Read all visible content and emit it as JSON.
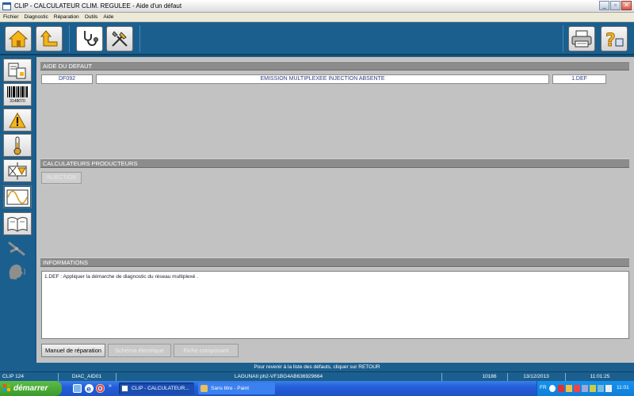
{
  "window": {
    "title": "CLIP - CALCULATEUR CLIM. REGULEE - Aide d'un défaut",
    "buttons": [
      "minimize",
      "maximize",
      "close"
    ]
  },
  "menu": [
    "Fichier",
    "Diagnostic",
    "Réparation",
    "Outils",
    "Aide"
  ],
  "toolbar": {
    "icons": [
      "home-icon",
      "back-arrow-icon",
      "stethoscope-icon",
      "tools-icon",
      "printer-icon",
      "help-icon"
    ]
  },
  "sidebar": {
    "icons": [
      "documents-icon",
      "barcode-icon",
      "warning-icon",
      "thermometer-icon",
      "actuator-icon",
      "oscilloscope-icon",
      "manual-book-icon",
      "pliers-icon",
      "speaker-head-icon"
    ],
    "barcode_text": "3148070"
  },
  "fault_help": {
    "header": "AIDE DU DEFAUT",
    "code": "DF092",
    "description": "EMISSION MULTIPLEXEE INJECTION ABSENTE",
    "def": "1.DEF"
  },
  "producers": {
    "header": "CALCULATEURS PRODUCTEURS",
    "button": "INJECTION"
  },
  "informations": {
    "header": "INFORMATIONS",
    "text": "1.DEF :  Appliquer la démarche de diagnostic du réseau multiplexé ."
  },
  "bottom_buttons": {
    "repair_manual": "Manuel de réparation",
    "electrical_diagram": "Schéma électrique",
    "component_sheet": "Fiche composant"
  },
  "status": {
    "message": "Pour revenir à la liste des défauts, cliquer sur RETOUR",
    "cells": [
      "CLIP 124",
      "DIAC_AID01",
      "LAGUNAII ph2-VF1BG4AB636929664",
      "10186",
      "13/12/2013",
      "11:01:25"
    ]
  },
  "taskbar": {
    "start": "démarrer",
    "items": [
      "CLIP - CALCULATEUR...",
      "Sans titre - Paint"
    ],
    "lang": "FR",
    "clock": "11:01"
  }
}
